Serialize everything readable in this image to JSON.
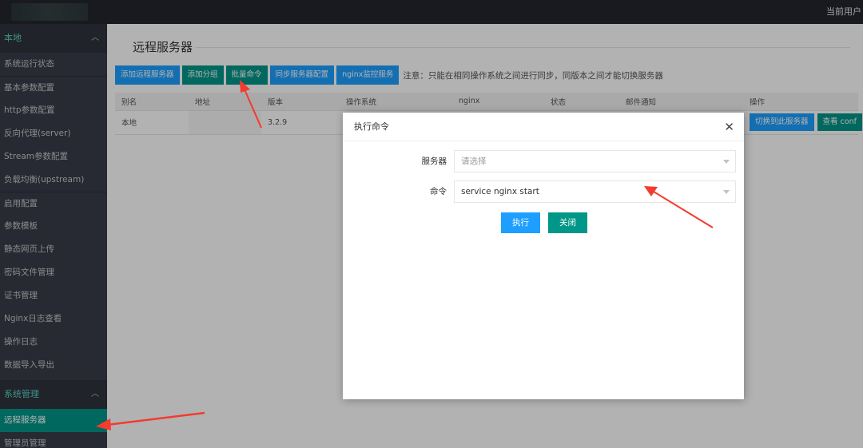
{
  "topbar": {
    "user_label": "当前用户"
  },
  "sidebar": {
    "groups": [
      {
        "label": "本地",
        "chevron": "^"
      },
      {
        "label": "系统管理",
        "chevron": "^"
      }
    ],
    "items": [
      "系统运行状态",
      "基本参数配置",
      "http参数配置",
      "反向代理(server)",
      "Stream参数配置",
      "负载均衡(upstream)",
      "启用配置",
      "参数模板",
      "静态网页上传",
      "密码文件管理",
      "证书管理",
      "Nginx日志查看",
      "操作日志",
      "数据导入导出",
      "远程服务器",
      "管理员管理"
    ]
  },
  "main": {
    "title": "远程服务器",
    "toolbar": {
      "buttons": [
        "添加远程服务器",
        "添加分组",
        "批量命令",
        "同步服务器配置",
        "nginx监控服务"
      ],
      "note": "注意：只能在相同操作系统之间进行同步，同版本之间才能切换服务器"
    },
    "table": {
      "headers": [
        "别名",
        "地址",
        "版本",
        "操作系统",
        "nginx",
        "状态",
        "邮件通知",
        "操作"
      ],
      "row": {
        "alias": "本地",
        "address": "",
        "version": "3.2.9"
      },
      "row_actions": [
        "切换到此服务器",
        "查看 conf"
      ]
    }
  },
  "dialog": {
    "title": "执行命令",
    "close": "✕",
    "server_label": "服务器",
    "server_placeholder": "请选择",
    "command_label": "命令",
    "command_value": "service nginx start",
    "execute": "执行",
    "close_btn": "关闭"
  },
  "colors": {
    "blue": "#1e9fff",
    "green": "#009688",
    "sidebar": "#393d49",
    "arrow": "#f33b2f"
  }
}
